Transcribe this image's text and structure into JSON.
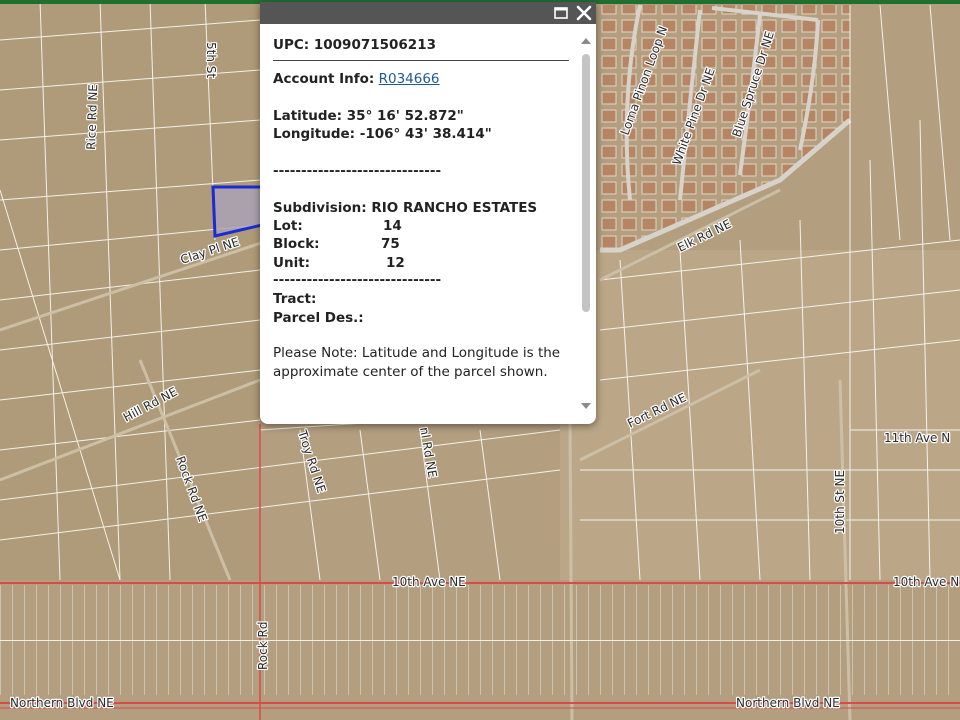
{
  "popup": {
    "upc_label": "UPC:",
    "upc_value": "1009071506213",
    "account_label": "Account Info:",
    "account_value": "R034666",
    "latitude_label": "Latitude:",
    "latitude_value": "35° 16' 52.872\"",
    "longitude_label": "Longitude:",
    "longitude_value": "-106° 43' 38.414\"",
    "separator_1": "------------------------------",
    "subdivision_label": "Subdivision:",
    "subdivision_value": "RIO RANCHO ESTATES",
    "lot_label": "Lot:",
    "lot_value": "14",
    "block_label": "Block:",
    "block_value": "75",
    "unit_label": "Unit:",
    "unit_value": "12",
    "separator_2": "------------------------------",
    "tract_label": "Tract:",
    "parcel_label": "Parcel Des.:",
    "note": "Please Note: Latitude and Longitude is the approximate center of the parcel shown.",
    "icons": {
      "maximize": "maximize-icon",
      "close": "close-icon",
      "scroll_up": "scroll-up-arrow-icon",
      "scroll_down": "scroll-down-arrow-icon"
    }
  },
  "map": {
    "streets": {
      "fifth_st": "5th St",
      "rice_rd": "Rice Rd NE",
      "clay_pl": "Clay Pl NE",
      "hill_rd": "Hill Rd NE",
      "rock_rd_ne": "Rock Rd NE",
      "troy_rd": "Troy Rd NE",
      "mid_rd": "nl Rd NE",
      "tenth_ave_a": "10th Ave NE",
      "tenth_ave_b": "10th Ave N",
      "eleventh_ave": "11th Ave N",
      "tenth_st": "10th St NE",
      "rock_rd": "Rock Rd",
      "northern_blvd_a": "Northern Blvd NE",
      "northern_blvd_b": "Northern Blvd NE",
      "loma_pinon": "Loma Pinon Loop N",
      "white_pine": "White Pine Dr NE",
      "blue_spruce": "Blue Spruce Dr NE",
      "elk_rd": "Elk Rd NE",
      "fort_rd": "Fort Rd NE"
    },
    "colors": {
      "terrain": "#b39e7f",
      "parcel_line": "#ffffff",
      "road_line": "#d94a4a",
      "selected_parcel": "#1a2bd6",
      "top_bar": "#1f6f2e"
    }
  }
}
